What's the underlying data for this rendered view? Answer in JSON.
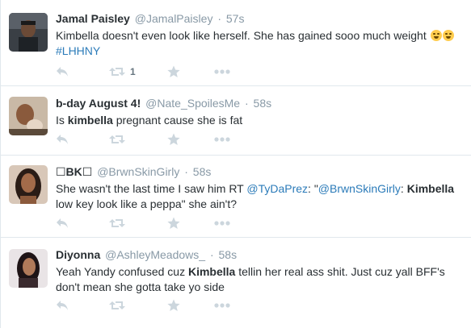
{
  "icons": {
    "reply": "reply-arrow-icon",
    "retweet": "retweet-icon",
    "favorite": "star-icon",
    "more": "more-dots-icon"
  },
  "colors": {
    "link": "#2b7bb9",
    "meta": "#8899a6",
    "action_icon": "#ccd6dd",
    "divider": "#e1e8ed",
    "text": "#292f33"
  },
  "tweets": [
    {
      "name": "Jamal Paisley",
      "handle": "@JamalPaisley",
      "sep": "·",
      "time": "57s",
      "text_a": "Kimbella doesn't even look like herself. She has gained sooo much weight",
      "emojis": [
        "tears-of-joy-emoji",
        "tired-face-emoji"
      ],
      "hashtag": "#LHHNY",
      "retweet_count": "1"
    },
    {
      "name": "b-day August 4!",
      "handle": "@Nate_SpoilesMe",
      "sep": "·",
      "time": "58s",
      "text_a": "Is ",
      "text_bold": "kimbella",
      "text_b": " pregnant cause she is fat"
    },
    {
      "name": "☐BK☐",
      "handle": "@BrwnSkinGirly",
      "sep": "·",
      "time": "58s",
      "text_a": "She wasn't the last time I saw him RT ",
      "mention1": "@TyDaPrez",
      "text_b": ": \"",
      "mention2": "@BrwnSkinGirly",
      "text_c": ": ",
      "text_bold": "Kimbella",
      "text_d": " low key look like a peppa\" she ain't?"
    },
    {
      "name": "Diyonna",
      "handle": "@AshleyMeadows_",
      "sep": "·",
      "time": "58s",
      "text_a": "Yeah Yandy confused cuz ",
      "text_bold": "Kimbella",
      "text_b": " tellin her real ass shit. Just cuz yall BFF's don't mean she gotta take yo side"
    }
  ]
}
